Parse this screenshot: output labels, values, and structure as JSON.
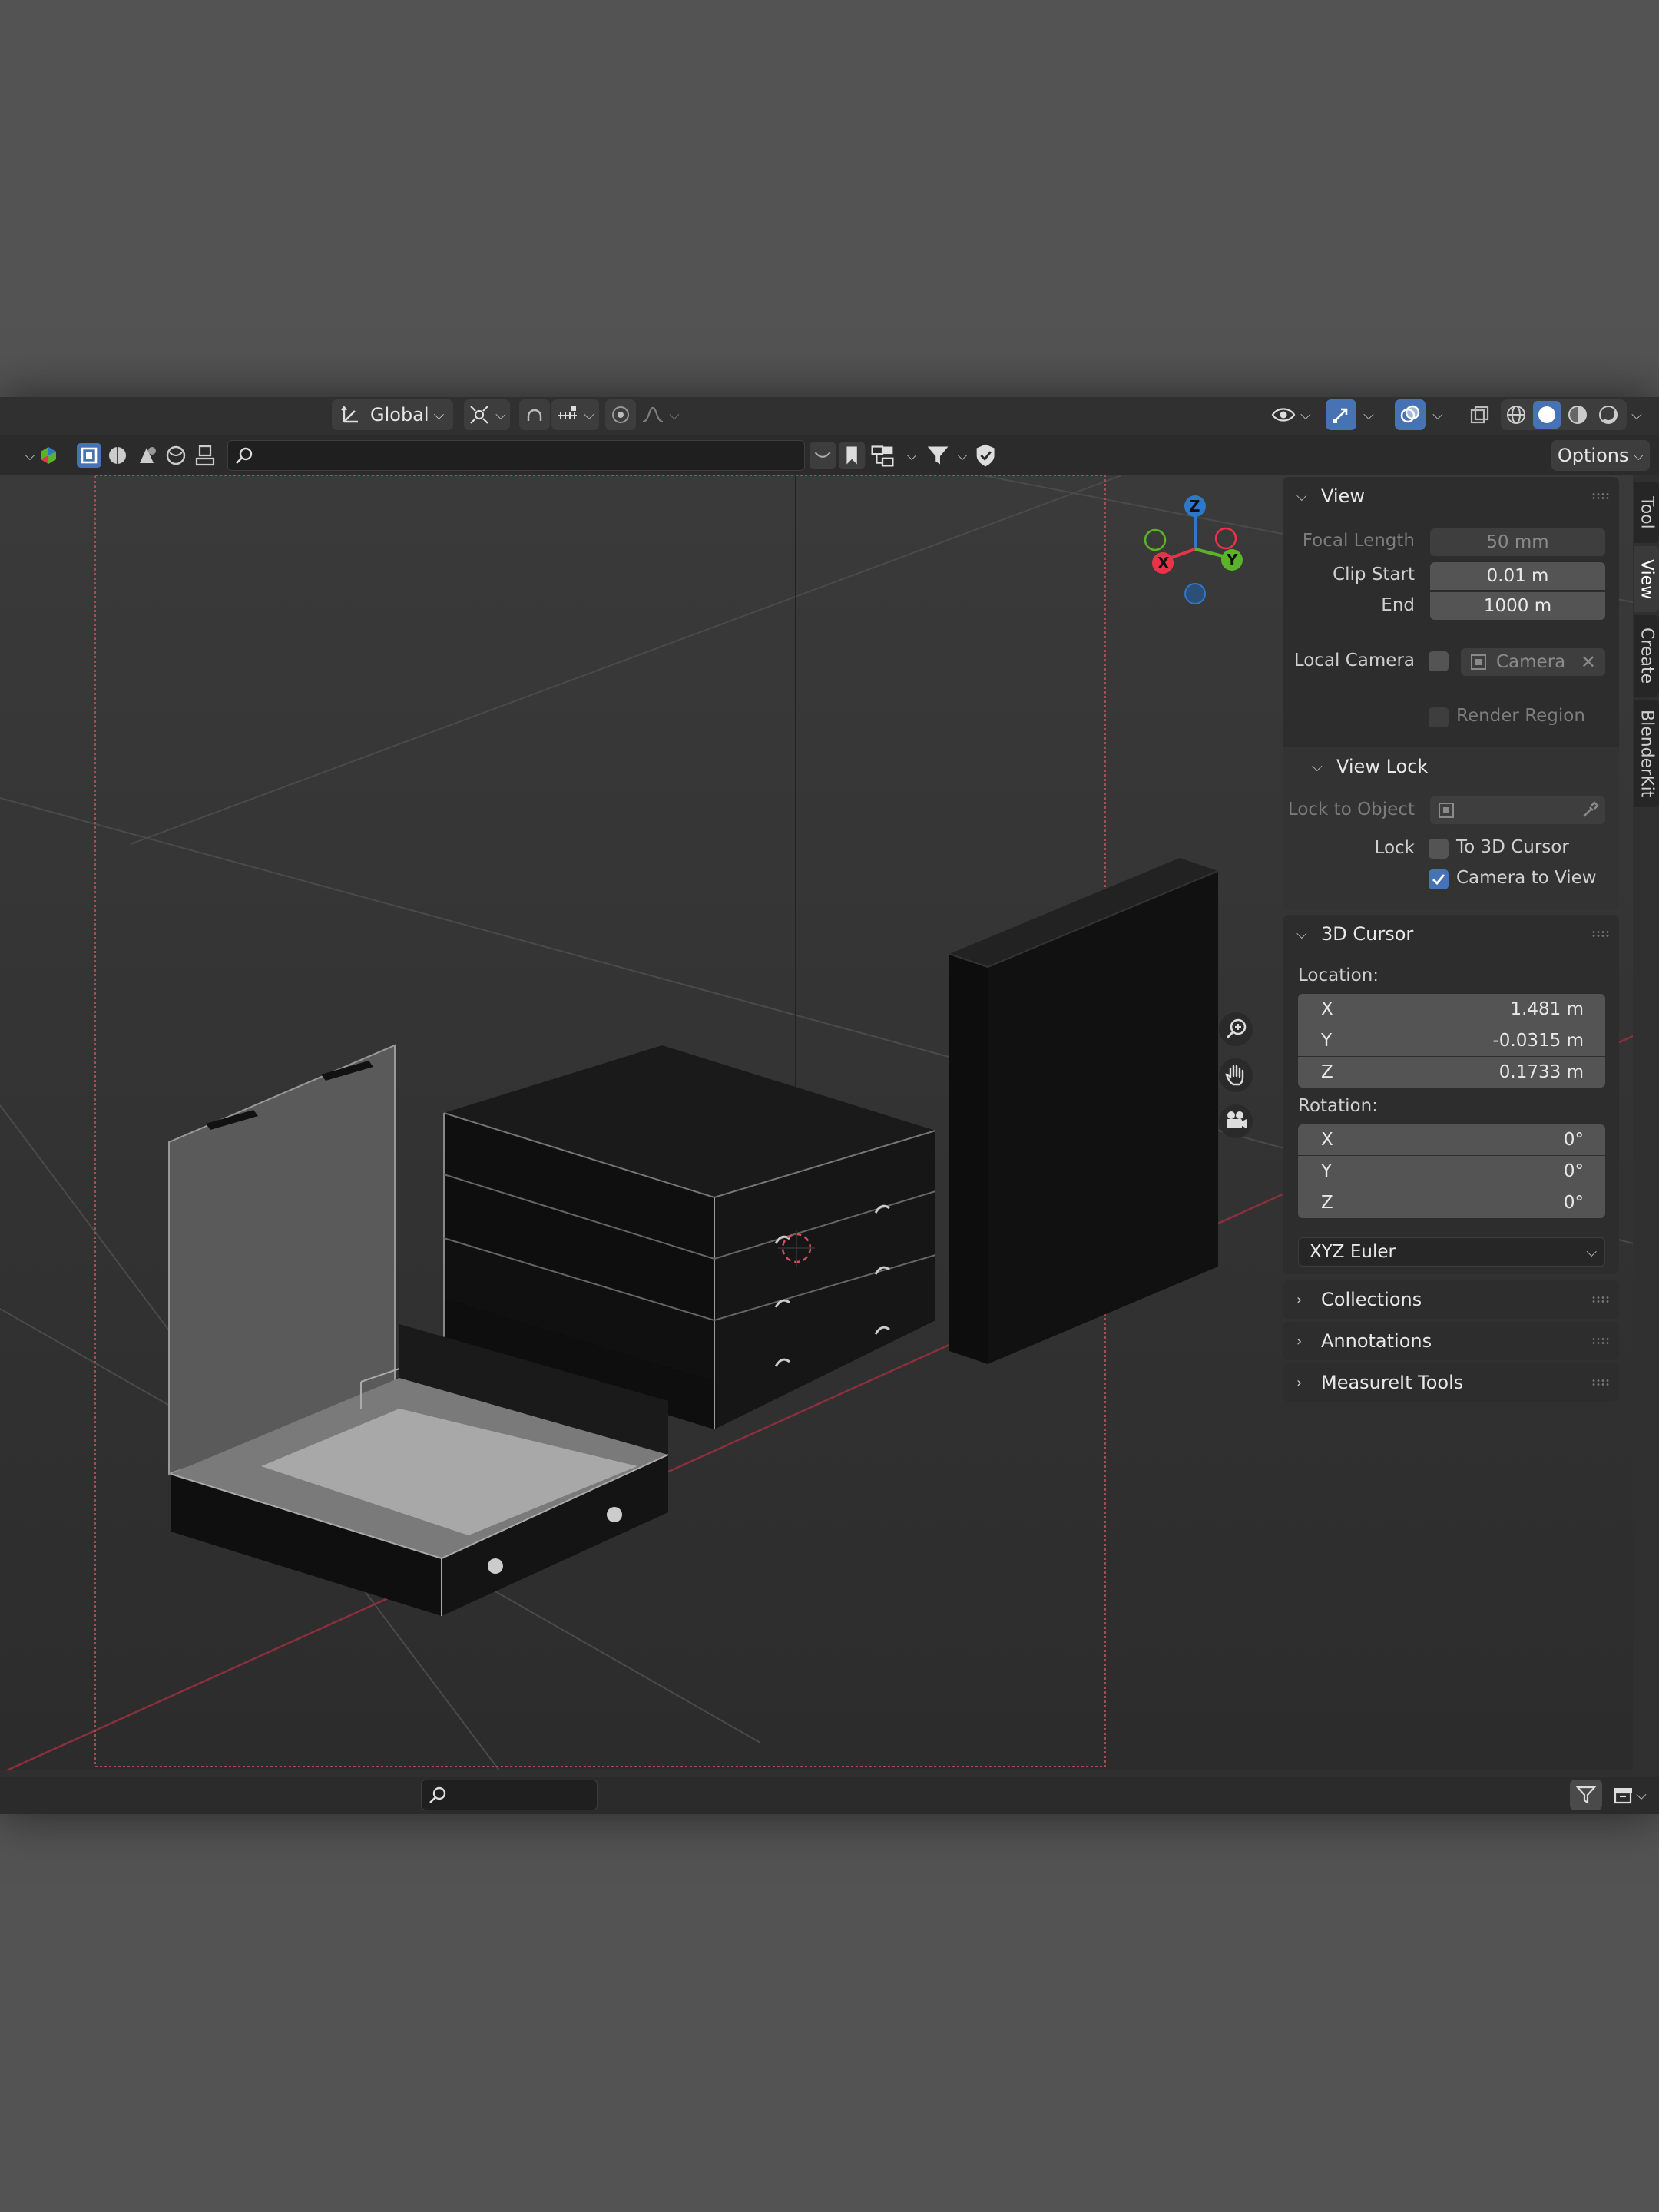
{
  "header": {
    "transform_orientation": "Global",
    "options_label": "Options"
  },
  "outliner_search": {
    "placeholder": ""
  },
  "footer_search": {
    "placeholder": ""
  },
  "sidebar_tabs": [
    "Tool",
    "View",
    "Create",
    "BlenderKit"
  ],
  "active_tab": "View",
  "view_panel": {
    "title": "View",
    "focal_length_label": "Focal Length",
    "focal_length_value": "50 mm",
    "clip_start_label": "Clip Start",
    "clip_start_value": "0.01 m",
    "end_label": "End",
    "end_value": "1000 m",
    "local_camera_label": "Local Camera",
    "local_camera_value": "Camera",
    "render_region_label": "Render Region",
    "view_lock": {
      "title": "View Lock",
      "lock_to_object_label": "Lock to Object",
      "lock_label": "Lock",
      "to_3d_cursor_label": "To 3D Cursor",
      "to_3d_cursor_checked": false,
      "camera_to_view_label": "Camera to View",
      "camera_to_view_checked": true
    }
  },
  "cursor_panel": {
    "title": "3D Cursor",
    "location_label": "Location:",
    "location": [
      {
        "axis": "X",
        "value": "1.481 m"
      },
      {
        "axis": "Y",
        "value": "-0.0315 m"
      },
      {
        "axis": "Z",
        "value": "0.1733 m"
      }
    ],
    "rotation_label": "Rotation:",
    "rotation": [
      {
        "axis": "X",
        "value": "0°"
      },
      {
        "axis": "Y",
        "value": "0°"
      },
      {
        "axis": "Z",
        "value": "0°"
      }
    ],
    "rotation_mode": "XYZ Euler"
  },
  "collapsed_panels": [
    "Collections",
    "Annotations",
    "MeasureIt Tools"
  ],
  "gizmo": {
    "x": "X",
    "y": "Y",
    "z": "Z"
  },
  "colors": {
    "accent": "#4772b3",
    "axis_x": "#e8334a",
    "axis_y": "#5bb32a",
    "axis_z": "#2e78c8",
    "panel_bg": "#2d2d2d"
  }
}
